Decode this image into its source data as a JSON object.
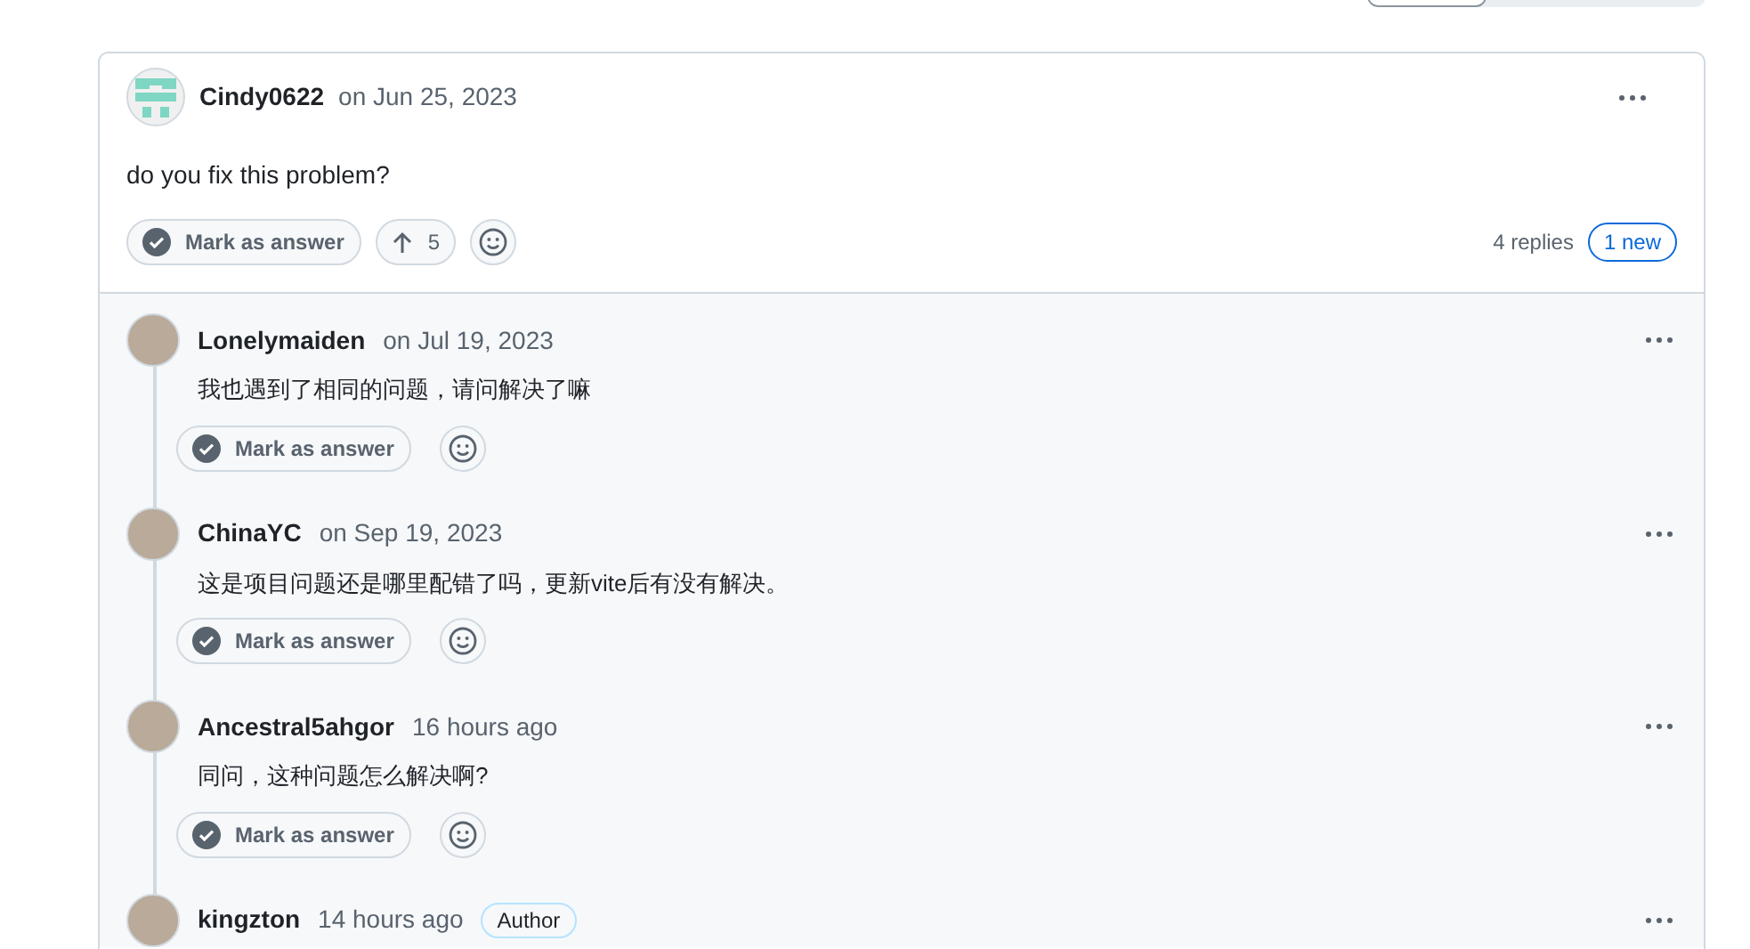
{
  "post": {
    "author": "Cindy0622",
    "time": "on Jun 25, 2023",
    "body": "do you fix this problem?",
    "mark_answer": "Mark as answer",
    "upvotes": "5",
    "replies_count": "4 replies",
    "new_badge": "1 new"
  },
  "replies": [
    {
      "author": "Lonelymaiden",
      "time": "on Jul 19, 2023",
      "body": "我也遇到了相同的问题，请问解决了嘛",
      "mark_answer": "Mark as answer"
    },
    {
      "author": "ChinaYC",
      "time": "on Sep 19, 2023",
      "body": "这是项目问题还是哪里配错了吗，更新vite后有没有解决。",
      "mark_answer": "Mark as answer"
    },
    {
      "author": "Ancestral5ahgor",
      "time": "16 hours ago",
      "body": "同问，这种问题怎么解决啊?",
      "mark_answer": "Mark as answer"
    },
    {
      "author": "kingzton",
      "time": "14 hours ago",
      "badge": "Author"
    }
  ]
}
